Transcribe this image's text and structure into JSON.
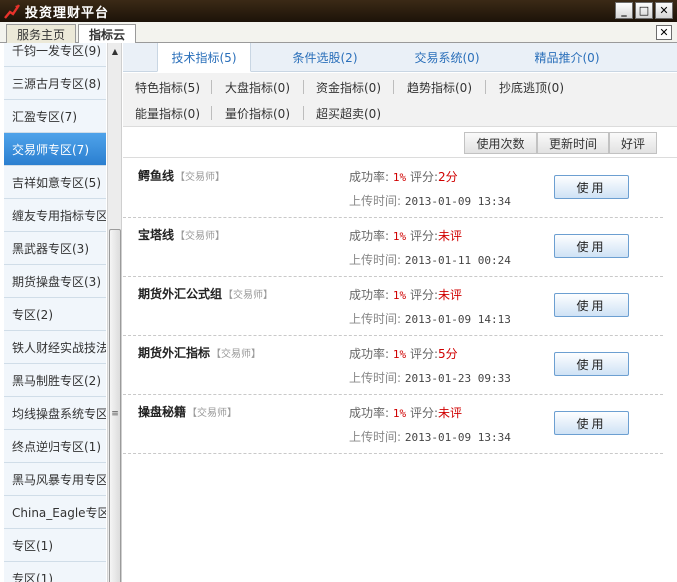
{
  "window": {
    "title": "投资理财平台",
    "minimize": "_",
    "maximize": "□",
    "close": "✕"
  },
  "top_tabs": [
    {
      "label": "服务主页",
      "active": false
    },
    {
      "label": "指标云",
      "active": true
    }
  ],
  "panel_close": "✕",
  "sidebar": {
    "items": [
      {
        "label": "千钧一发专区(9)"
      },
      {
        "label": "三源古月专区(8)"
      },
      {
        "label": "汇盈专区(7)"
      },
      {
        "label": "交易师专区(7)",
        "active": true
      },
      {
        "label": "吉祥如意专区(5)"
      },
      {
        "label": "缠友专用指标专区"
      },
      {
        "label": "黑武器专区(3)"
      },
      {
        "label": "期货操盘专区(3)"
      },
      {
        "label": "专区(2)"
      },
      {
        "label": "铁人财经实战技法"
      },
      {
        "label": "黑马制胜专区(2)"
      },
      {
        "label": "均线操盘系统专区"
      },
      {
        "label": "终点逆归专区(1)"
      },
      {
        "label": "黑马风暴专用专区"
      },
      {
        "label": "China_Eagle专区"
      },
      {
        "label": "专区(1)"
      },
      {
        "label": "专区(1)"
      }
    ],
    "scroll_up": "▲",
    "scroll_grip": "≡"
  },
  "category_tabs": [
    {
      "label": "技术指标(5)",
      "active": true
    },
    {
      "label": "条件选股(2)"
    },
    {
      "label": "交易系统(0)"
    },
    {
      "label": "精品推介(0)"
    }
  ],
  "filters": [
    [
      "特色指标(5)",
      "大盘指标(0)",
      "资金指标(0)",
      "趋势指标(0)",
      "抄底逃顶(0)"
    ],
    [
      "能量指标(0)",
      "量价指标(0)",
      "超买超卖(0)"
    ]
  ],
  "sort_buttons": [
    "使用次数",
    "更新时间",
    "好评"
  ],
  "labels": {
    "success_rate": "成功率:",
    "rating": "评分:",
    "upload_time": "上传时间:",
    "use": "使用"
  },
  "results": [
    {
      "name": "鳄鱼线",
      "tag": "【交易师】",
      "success_rate": "1%",
      "rating": "2分",
      "upload_time": "2013-01-09 13:34"
    },
    {
      "name": "宝塔线",
      "tag": "【交易师】",
      "success_rate": "1%",
      "rating": "未评",
      "upload_time": "2013-01-11 00:24"
    },
    {
      "name": "期货外汇公式组",
      "tag": "【交易师】",
      "success_rate": "1%",
      "rating": "未评",
      "upload_time": "2013-01-09 14:13"
    },
    {
      "name": "期货外汇指标",
      "tag": "【交易师】",
      "success_rate": "1%",
      "rating": "5分",
      "upload_time": "2013-01-23 09:33"
    },
    {
      "name": "操盘秘籍",
      "tag": "【交易师】",
      "success_rate": "1%",
      "rating": "未评",
      "upload_time": "2013-01-09 13:34"
    }
  ]
}
